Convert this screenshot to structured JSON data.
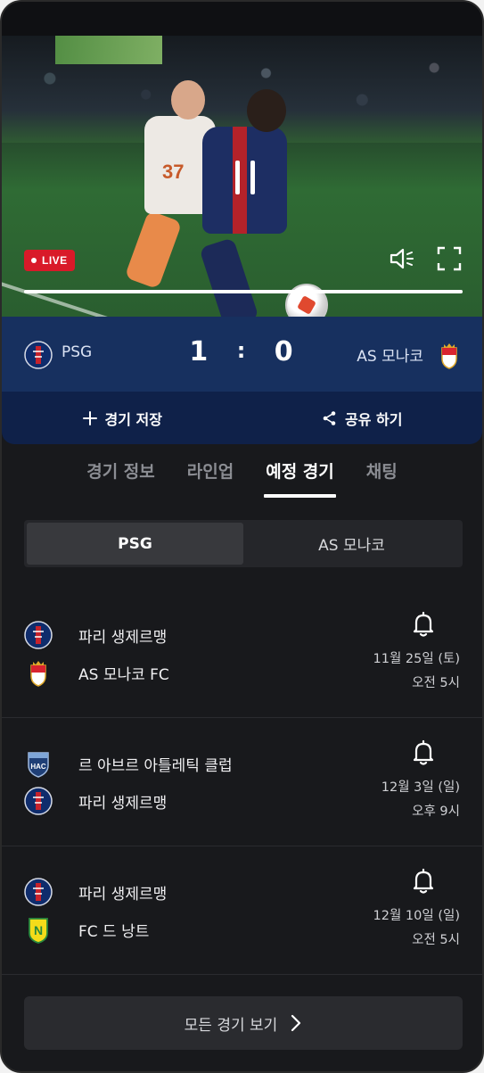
{
  "video": {
    "live_label": "LIVE",
    "progress": 1.0
  },
  "scoreboard": {
    "home_team": "PSG",
    "away_team": "AS 모나코",
    "home_score": "1",
    "separator": ":",
    "away_score": "0"
  },
  "actions": {
    "save_label": "경기 저장",
    "share_label": "공유 하기"
  },
  "tabs": [
    {
      "label": "경기 정보",
      "active": false
    },
    {
      "label": "라인업",
      "active": false
    },
    {
      "label": "예정 경기",
      "active": true
    },
    {
      "label": "채팅",
      "active": false
    }
  ],
  "team_toggle": {
    "options": [
      "PSG",
      "AS 모나코"
    ],
    "selected": "PSG"
  },
  "matches": [
    {
      "team1": "파리 생제르맹",
      "team2": "AS 모나코 FC",
      "date": "11월 25일 (토)",
      "time": "오전 5시"
    },
    {
      "team1": "르 아브르 아틀레틱 클럽",
      "team2": "파리 생제르맹",
      "date": "12월 3일 (일)",
      "time": "오후 9시"
    },
    {
      "team1": "파리 생제르맹",
      "team2": "FC 드 낭트",
      "date": "12월 10일 (일)",
      "time": "오전 5시"
    }
  ],
  "footer": {
    "all_matches_label": "모든 경기 보기"
  },
  "colors": {
    "scoreboard_bg": "#17305f",
    "action_bar_bg": "#0f2149",
    "live_red": "#d91a29",
    "page_bg": "#18191c"
  },
  "icons": {
    "psg": "psg-crest-icon",
    "monaco": "monaco-crest-icon",
    "le_havre": "le-havre-crest-icon",
    "nantes": "nantes-crest-icon",
    "bell": "bell-icon",
    "chevron": "chevron-right-icon",
    "plus": "plus-icon",
    "share": "share-icon",
    "volume": "volume-icon",
    "fullscreen": "fullscreen-icon",
    "pause": "pause-icon"
  }
}
